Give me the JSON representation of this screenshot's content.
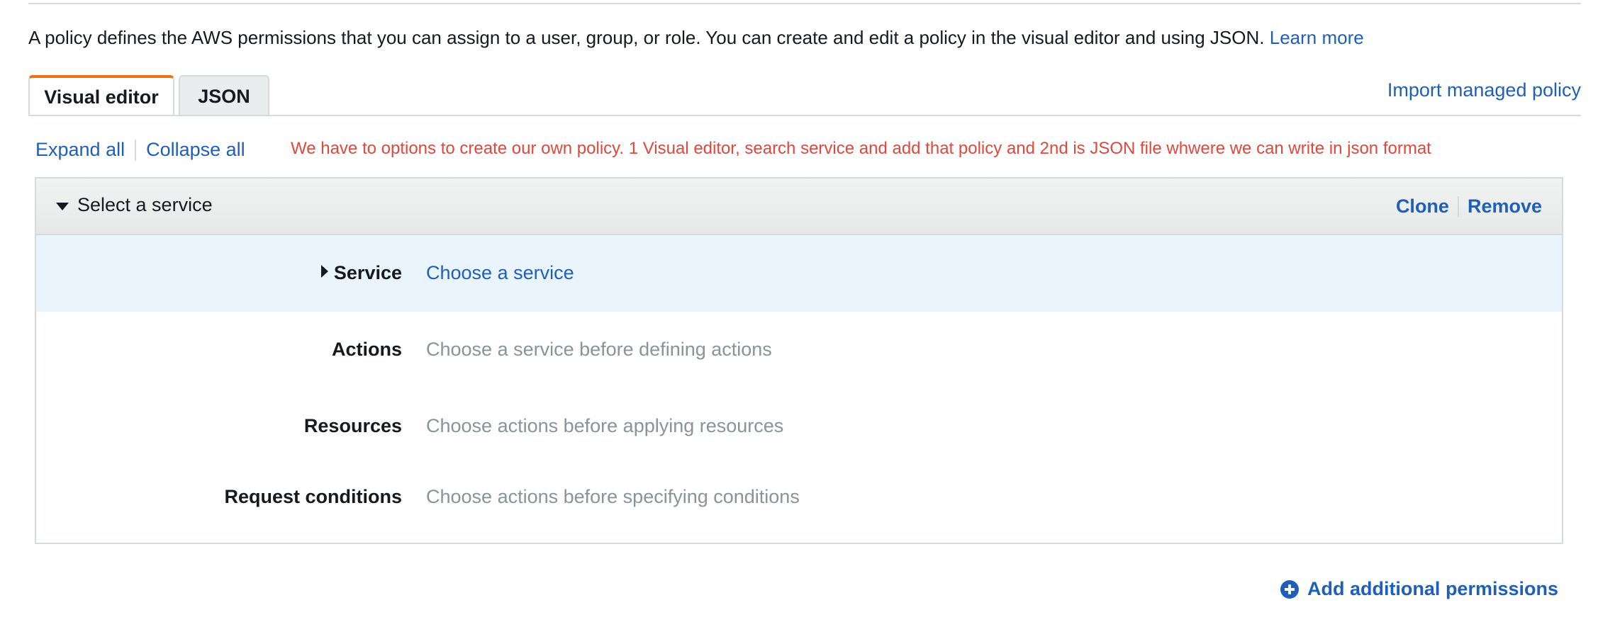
{
  "intro": {
    "text": "A policy defines the AWS permissions that you can assign to a user, group, or role. You can create and edit a policy in the visual editor and using JSON.",
    "learn_more": "Learn more"
  },
  "tabs": [
    {
      "label": "Visual editor",
      "active": true
    },
    {
      "label": "JSON",
      "active": false
    }
  ],
  "import_link": "Import managed policy",
  "controls": {
    "expand_all": "Expand all",
    "collapse_all": "Collapse all"
  },
  "note": "We have to options to create our own policy. 1 Visual editor, search service and add that policy and 2nd is JSON file whwere we can write in json format",
  "panel": {
    "title": "Select a service",
    "clone": "Clone",
    "remove": "Remove",
    "rows": [
      {
        "label": "Service",
        "value": "Choose a service"
      },
      {
        "label": "Actions",
        "value": "Choose a service before defining actions"
      },
      {
        "label": "Resources",
        "value": "Choose actions before applying resources"
      },
      {
        "label": "Request conditions",
        "value": "Choose actions before specifying conditions"
      }
    ]
  },
  "add_permissions": "Add additional permissions",
  "colors": {
    "link": "#1f5fb8",
    "note": "#e0483c",
    "active_tab_accent": "#ec7211",
    "service_row_bg": "#e9f4fd"
  }
}
